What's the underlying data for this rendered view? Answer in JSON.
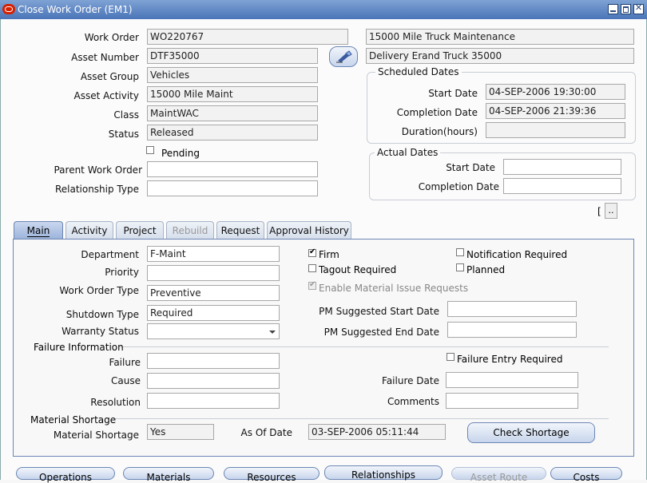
{
  "window": {
    "title": "Close Work Order (EM1)"
  },
  "header": {
    "work_order_label": "Work Order",
    "work_order": "WO220767",
    "wo_description": "15000 Mile Truck Maintenance",
    "asset_number_label": "Asset Number",
    "asset_number": "DTF35000",
    "asset_description": "Delivery Erand Truck 35000",
    "asset_group_label": "Asset Group",
    "asset_group": "Vehicles",
    "asset_activity_label": "Asset Activity",
    "asset_activity": "15000 Mile Maint",
    "class_label": "Class",
    "class": "MaintWAC",
    "status_label": "Status",
    "status": "Released",
    "pending_label": "Pending",
    "parent_wo_label": "Parent Work Order",
    "parent_wo": "",
    "relationship_type_label": "Relationship Type",
    "relationship_type": ""
  },
  "scheduled_dates": {
    "title": "Scheduled Dates",
    "start_label": "Start Date",
    "start": "04-SEP-2006 19:30:00",
    "completion_label": "Completion Date",
    "completion": "04-SEP-2006 21:39:36",
    "duration_label": "Duration(hours)",
    "duration": ""
  },
  "actual_dates": {
    "title": "Actual Dates",
    "start_label": "Start Date",
    "start": "",
    "completion_label": "Completion Date",
    "completion": ""
  },
  "bracket_label": "[",
  "bracket_button": "..",
  "tabs": [
    "Main",
    "Activity",
    "Project",
    "Rebuild",
    "Request",
    "Approval History"
  ],
  "main": {
    "department_label": "Department",
    "department": "F-Maint",
    "priority_label": "Priority",
    "priority": "",
    "wo_type_label": "Work Order Type",
    "wo_type": "Preventive",
    "shutdown_label": "Shutdown Type",
    "shutdown": "Required",
    "warranty_label": "Warranty Status",
    "warranty": "",
    "firm_label": "Firm",
    "tagout_label": "Tagout Required",
    "material_issue_label": "Enable Material Issue Requests",
    "notification_label": "Notification Required",
    "planned_label": "Planned",
    "pm_start_label": "PM Suggested Start Date",
    "pm_start": "",
    "pm_end_label": "PM Suggested End Date",
    "pm_end": ""
  },
  "failure": {
    "title": "Failure Information",
    "failure_label": "Failure",
    "failure": "",
    "cause_label": "Cause",
    "cause": "",
    "resolution_label": "Resolution",
    "resolution": "",
    "entry_required_label": "Failure Entry Required",
    "date_label": "Failure Date",
    "date": "",
    "comments_label": "Comments",
    "comments": ""
  },
  "shortage": {
    "title": "Material Shortage",
    "label": "Material Shortage",
    "value": "Yes",
    "as_of_label": "As Of Date",
    "as_of": "03-SEP-2006 05:11:44",
    "check_button": "Check Shortage"
  },
  "bottom_buttons": [
    "Operations",
    "Materials",
    "Resources",
    "Relationships",
    "Asset Route",
    "Costs"
  ]
}
